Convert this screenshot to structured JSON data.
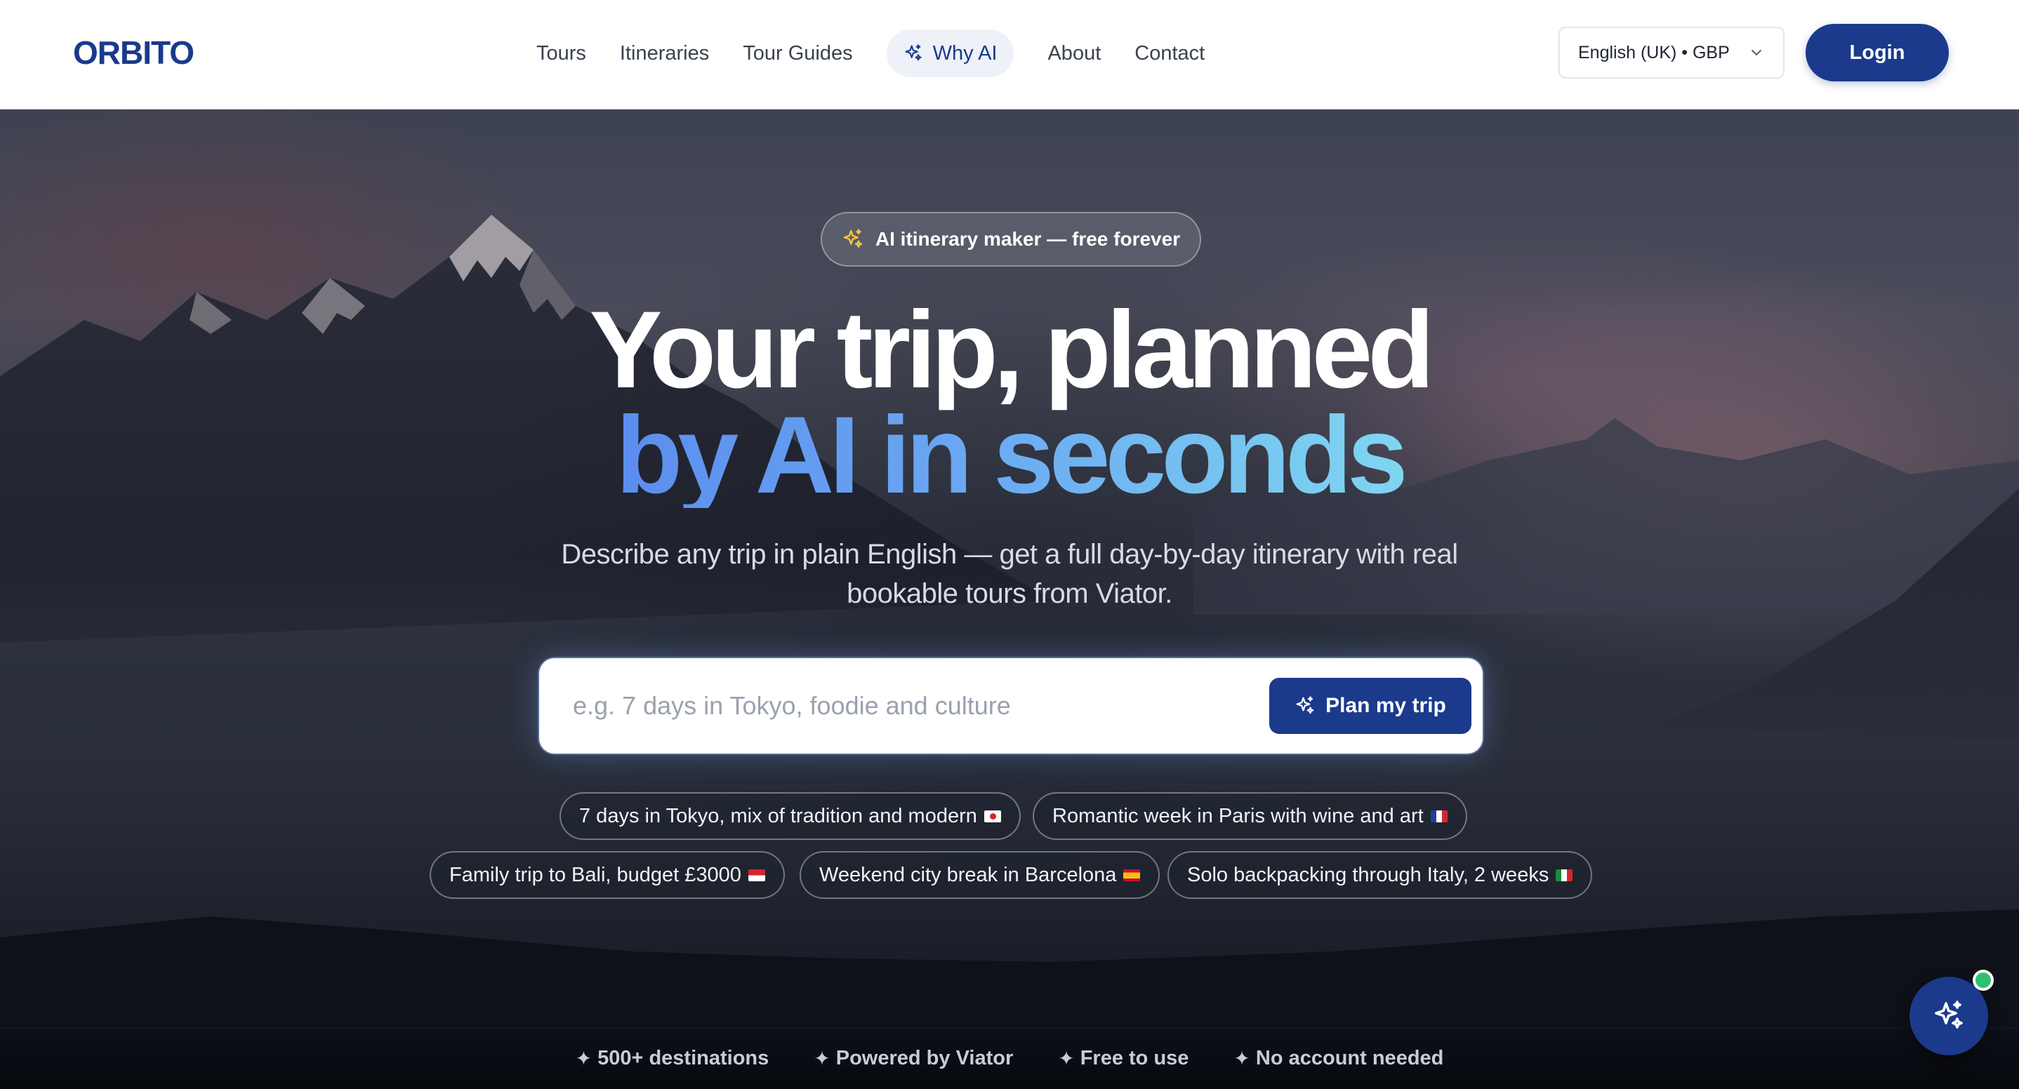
{
  "header": {
    "logo": "ORBITO",
    "nav": {
      "tours": "Tours",
      "itineraries": "Itineraries",
      "tour_guides": "Tour Guides",
      "why_ai": "Why AI",
      "about": "About",
      "contact": "Contact"
    },
    "locale": "English (UK) • GBP",
    "login": "Login"
  },
  "hero": {
    "badge": "AI itinerary maker — free forever",
    "headline_line1": "Your trip, planned",
    "headline_line2": "by AI in seconds",
    "subtitle": "Describe any trip in plain English — get a full day-by-day itinerary with real bookable tours from Viator.",
    "search": {
      "placeholder": "e.g. 7 days in Tokyo, foodie and culture",
      "value": ""
    },
    "plan_button": "Plan my trip",
    "suggestions": [
      "7 days in Tokyo, mix of tradition and modern",
      "Romantic week in Paris with wine and art",
      "Family trip to Bali, budget £3000",
      "Weekend city break in Barcelona",
      "Solo backpacking through Italy, 2 weeks"
    ]
  },
  "features": [
    "500+ destinations",
    "Powered by Viator",
    "Free to use",
    "No account needed"
  ],
  "colors": {
    "brand": "#1b3a8c",
    "headline_gradient_start": "#5b8def",
    "headline_gradient_end": "#7fd6f0",
    "status_dot": "#2fbf71"
  },
  "icons": {
    "sparkle": "sparkles-icon",
    "chevron": "chevron-down-icon",
    "fab": "ai-assistant-icon"
  }
}
